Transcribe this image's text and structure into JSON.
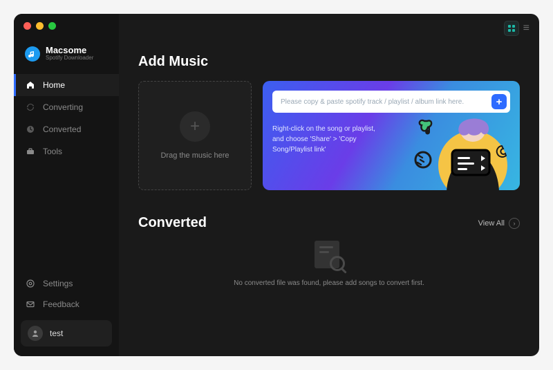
{
  "brand": {
    "name": "Macsome",
    "subtitle": "Spotify Downloader"
  },
  "sidebar": {
    "items": [
      {
        "id": "home",
        "label": "Home",
        "active": true
      },
      {
        "id": "converting",
        "label": "Converting",
        "active": false
      },
      {
        "id": "converted",
        "label": "Converted",
        "active": false
      },
      {
        "id": "tools",
        "label": "Tools",
        "active": false
      }
    ],
    "footer": [
      {
        "id": "settings",
        "label": "Settings"
      },
      {
        "id": "feedback",
        "label": "Feedback"
      }
    ]
  },
  "account": {
    "username": "test"
  },
  "addMusic": {
    "title": "Add Music",
    "dropzone": "Drag the music here",
    "placeholder": "Please copy & paste spotify track / playlist / album link here.",
    "hint": "Right-click on the song or playlist, and choose 'Share' > 'Copy Song/Playlist link'"
  },
  "converted": {
    "title": "Converted",
    "viewAll": "View All",
    "emptyMessage": "No converted file was found, please add songs to convert first."
  }
}
